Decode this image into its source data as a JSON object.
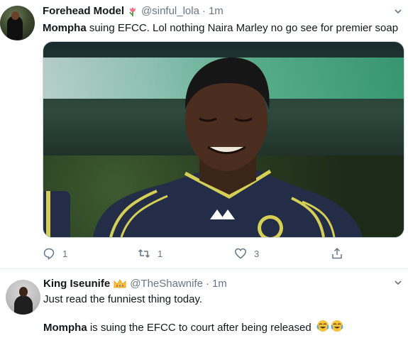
{
  "tweets": [
    {
      "name": "Forehead Model",
      "handle": "@sinful_lola",
      "dot": "·",
      "time": "1m",
      "text_bold": "Mompha",
      "text_rest": " suing EFCC. Lol nothing Naira Marley no go see for premier soap",
      "replies": "1",
      "retweets": "1",
      "likes": "3",
      "name_emoji": "tulip-emoji",
      "media": "photo-of-footballer-in-navy-striped-jersey"
    },
    {
      "name": "King Iseunife",
      "handle": "@TheShawnife",
      "dot": "·",
      "time": "1m",
      "line1": "Just read the funniest thing today.",
      "line2_bold": "Mompha",
      "line2_rest": " is suing the EFCC to court after being released",
      "name_emoji": "crown-emoji",
      "trailing_emojis": "😂😂"
    }
  ],
  "icons": {
    "caret": "chevron-down-icon",
    "reply": "reply-icon",
    "retweet": "retweet-icon",
    "like": "heart-icon",
    "share": "share-icon"
  },
  "colors": {
    "muted": "#657786",
    "text": "#14171a",
    "jersey_navy": "#232d47",
    "jersey_stripe": "#d6cf55"
  }
}
